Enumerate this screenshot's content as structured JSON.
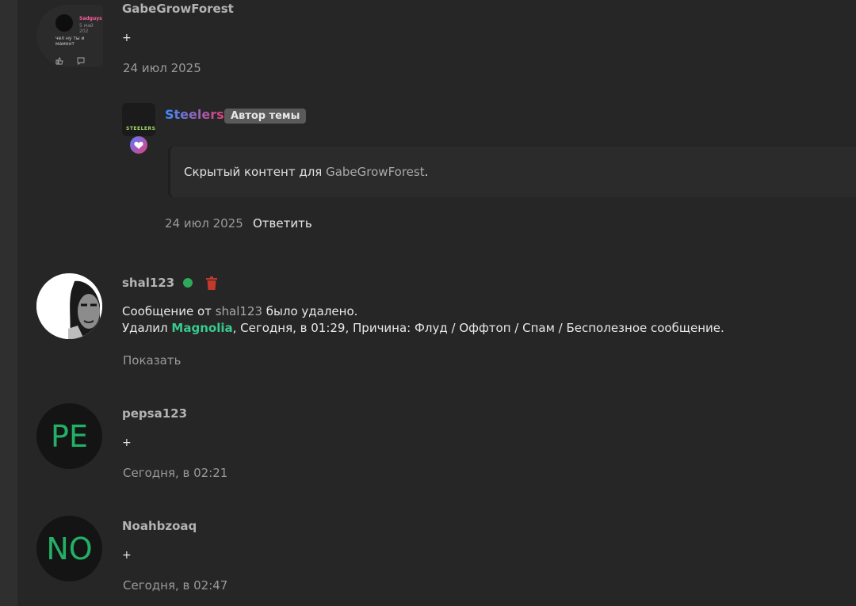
{
  "colors": {
    "background": "#262626",
    "username": "#b3b3b3",
    "magnolia": "#37c98e",
    "avatar_letters": "#22b066",
    "online": "#2ea85a",
    "trash": "#c0392b"
  },
  "posts": [
    {
      "username": "GabeGrowForest",
      "thumbnail": {
        "name": "Sadguys",
        "date": "5 май 202",
        "message": "чел ну ты и мамонт"
      },
      "text": "+",
      "date": "24 июл 2025",
      "reply": {
        "username": "Steelers",
        "avatar_logo": "STEELERS",
        "badge": "Автор темы",
        "hidden_prefix": "Скрытый контент для",
        "hidden_user": "GabeGrowForest",
        "hidden_suffix": ".",
        "date": "24 июл 2025",
        "reply_label": "Ответить"
      }
    },
    {
      "username": "shal123",
      "deleted_prefix": "Сообщение от",
      "deleted_user": "shal123",
      "deleted_suffix": "было удалено.",
      "deleted_by_prefix": "Удалил",
      "deleted_by": "Magnolia",
      "deleted_details": ", Сегодня, в 01:29, Причина: Флуд / Оффтоп / Спам / Бесполезное сообщение.",
      "show_label": "Показать"
    },
    {
      "username": "pepsa123",
      "initials": "PE",
      "text": "+",
      "date": "Сегодня, в 02:21"
    },
    {
      "username": "Noahbzoaq",
      "initials": "NO",
      "text": "+",
      "date": "Сегодня, в 02:47"
    }
  ]
}
